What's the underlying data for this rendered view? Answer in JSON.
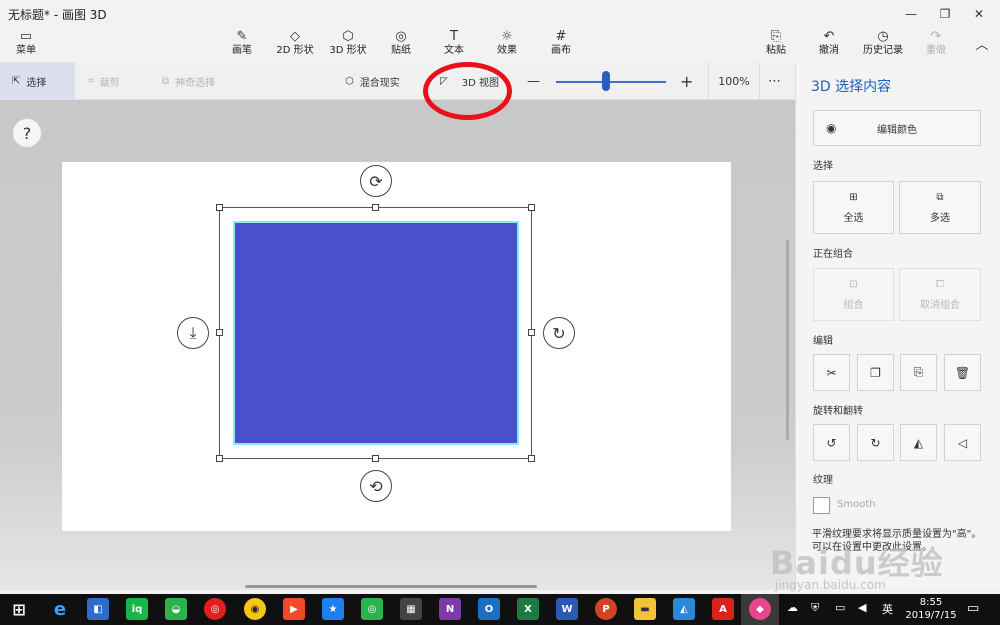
{
  "window": {
    "title": "无标题* - 画图 3D",
    "minimize": "—",
    "restore": "❐",
    "close": "✕"
  },
  "ribbon": {
    "menu": {
      "label": "菜单",
      "icon": "folder-icon",
      "glyph": "▭"
    },
    "tools": [
      {
        "label": "画笔",
        "icon": "brush-icon",
        "glyph": "✎"
      },
      {
        "label": "2D 形状",
        "icon": "2d-shapes-icon",
        "glyph": "◇"
      },
      {
        "label": "3D 形状",
        "icon": "3d-shapes-icon",
        "glyph": "⬡"
      },
      {
        "label": "贴纸",
        "icon": "stickers-icon",
        "glyph": "◎"
      },
      {
        "label": "文本",
        "icon": "text-icon",
        "glyph": "T"
      },
      {
        "label": "效果",
        "icon": "effects-icon",
        "glyph": "☼"
      },
      {
        "label": "画布",
        "icon": "canvas-icon",
        "glyph": "#"
      }
    ],
    "paste": {
      "label": "粘贴",
      "glyph": "⎘"
    },
    "undo": {
      "label": "撤消",
      "glyph": "↶"
    },
    "history": {
      "label": "历史记录",
      "glyph": "◷"
    },
    "redo": {
      "label": "重做",
      "glyph": "↷"
    },
    "collapse": "︿"
  },
  "subbar": {
    "select": "选择",
    "crop": "裁剪",
    "magic_select": "神奇选择",
    "mixed_reality": "混合现实",
    "view_3d": "3D 视图",
    "zoom_minus": "—",
    "zoom_plus": "+",
    "zoom_level": "100%",
    "more": "⋯",
    "zoom_value_fraction": 0.45
  },
  "workspace": {
    "help": "?",
    "shape_color": "#4a50cc",
    "highlight_color": "#e8101a"
  },
  "panel": {
    "title": "3D 选择内容",
    "edit_color": "编辑颜色",
    "section_select": "选择",
    "select_all": "全选",
    "multi_select": "多选",
    "section_group": "正在组合",
    "group": "组合",
    "ungroup": "取消组合",
    "section_edit": "编辑",
    "section_rotate": "旋转和翻转",
    "section_texture": "纹理",
    "smooth": "Smooth",
    "note": "平滑纹理要求将显示质量设置为\"高\"。可以在设置中更改此设置。"
  },
  "watermark": {
    "brand": "Baidu经验",
    "url": "jingyan.baidu.com"
  },
  "taskbar": {
    "language": "英",
    "time": "8:55",
    "date": "2019/7/15"
  }
}
